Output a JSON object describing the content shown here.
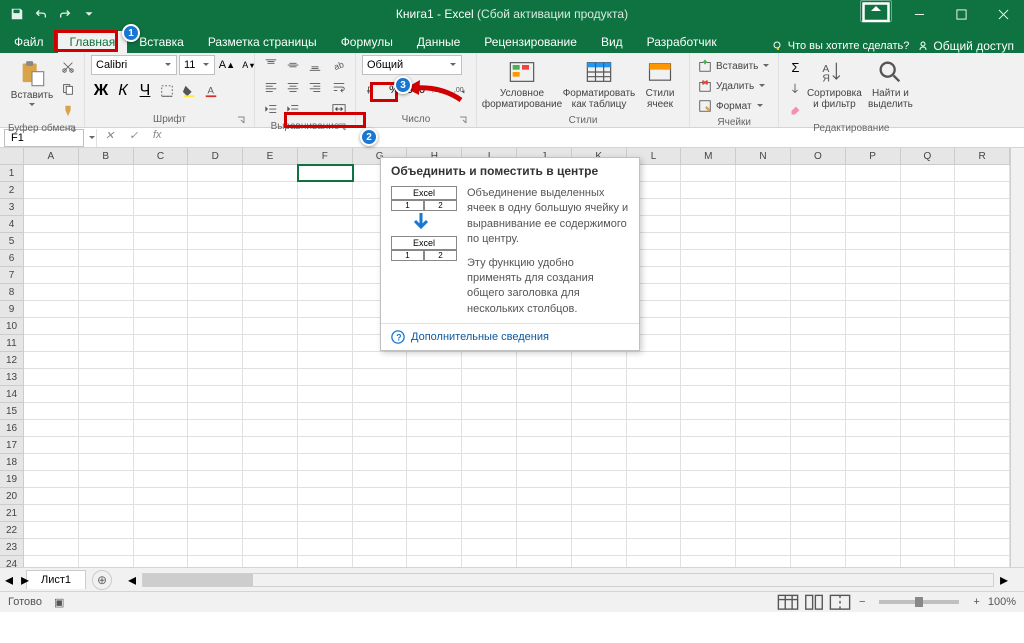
{
  "title": {
    "main": "Книга1 - Excel",
    "sub": " (Сбой активации продукта)"
  },
  "tabs": [
    "Файл",
    "Главная",
    "Вставка",
    "Разметка страницы",
    "Формулы",
    "Данные",
    "Рецензирование",
    "Вид",
    "Разработчик"
  ],
  "tell_me": "Что вы хотите сделать?",
  "share": "Общий доступ",
  "groups": {
    "clipboard": "Буфер обмена",
    "font": "Шрифт",
    "alignment": "Выравнивание",
    "number": "Число",
    "styles": "Стили",
    "cells": "Ячейки",
    "editing": "Редактирование"
  },
  "paste": "Вставить",
  "font_name": "Calibri",
  "font_size": "11",
  "bold": "Ж",
  "italic": "К",
  "underline": "Ч",
  "num_format": "Общий",
  "cond_format": "Условное\nформатирование",
  "format_table": "Форматировать\nкак таблицу",
  "cell_styles": "Стили\nячеек",
  "insert": "Вставить",
  "delete": "Удалить",
  "format": "Формат",
  "sort_filter": "Сортировка\nи фильтр",
  "find_select": "Найти и\nвыделить",
  "name_box": "F1",
  "sheet": "Лист1",
  "status": "Готово",
  "zoom": "100%",
  "columns": [
    "A",
    "B",
    "C",
    "D",
    "E",
    "F",
    "G",
    "H",
    "I",
    "J",
    "K",
    "L",
    "M",
    "N",
    "O",
    "P",
    "Q",
    "R"
  ],
  "rows": [
    "1",
    "2",
    "3",
    "4",
    "5",
    "6",
    "7",
    "8",
    "9",
    "10",
    "11",
    "12",
    "13",
    "14",
    "15",
    "16",
    "17",
    "18",
    "19",
    "20",
    "21",
    "22",
    "23",
    "24"
  ],
  "tooltip": {
    "title": "Объединить и поместить в центре",
    "p1": "Объединение выделенных ячеек в одну большую ячейку и выравнивание ее содержимого по центру.",
    "p2": "Эту функцию удобно применять для создания общего заголовка для нескольких столбцов.",
    "link": "Дополнительные сведения",
    "diagram_label": "Excel",
    "diagram_1": "1",
    "diagram_2": "2"
  },
  "callouts": {
    "c1": "1",
    "c2": "2",
    "c3": "3"
  }
}
